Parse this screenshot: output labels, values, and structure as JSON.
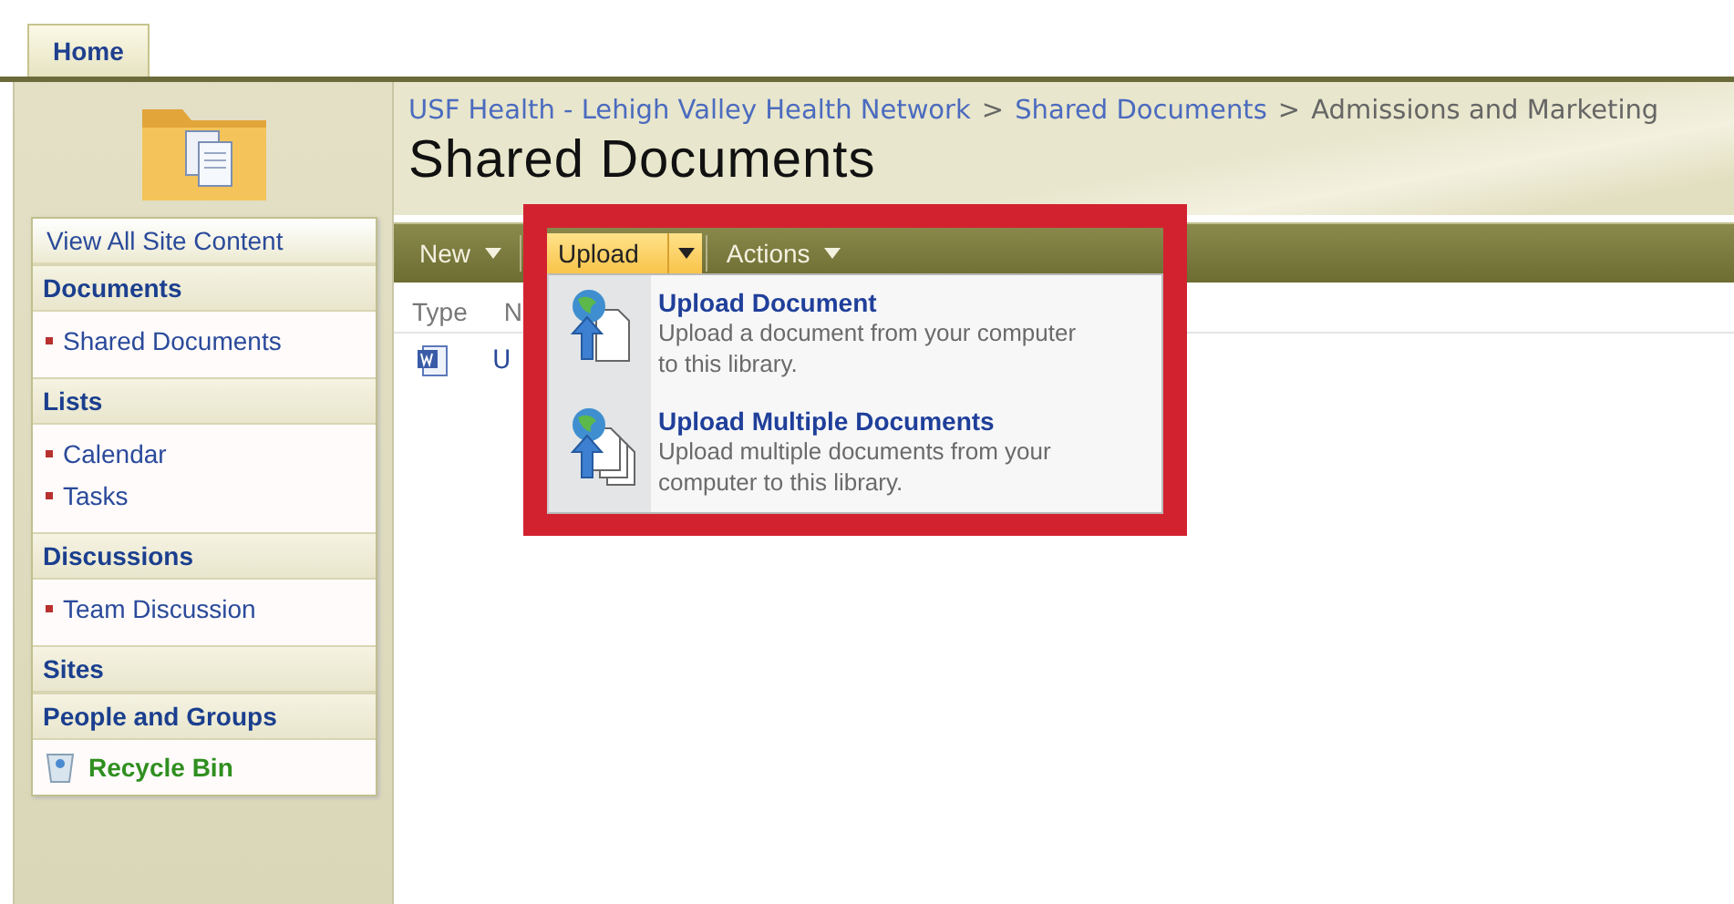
{
  "tabs": [
    {
      "label": "Home",
      "selected": true
    }
  ],
  "breadcrumb": [
    {
      "label": "USF Health - Lehigh Valley Health Network",
      "link": true
    },
    {
      "separator": ">",
      "label": "Shared Documents",
      "link": true
    },
    {
      "separator": ">",
      "label": "Admissions and Marketing",
      "link": false
    }
  ],
  "title": "Shared Documents",
  "sidebar": {
    "view_all": "View All Site Content",
    "sections": [
      {
        "heading": "Documents",
        "items": [
          "Shared Documents"
        ]
      },
      {
        "heading": "Lists",
        "items": [
          "Calendar",
          "Tasks"
        ]
      },
      {
        "heading": "Discussions",
        "items": [
          "Team Discussion"
        ]
      },
      {
        "heading": "Sites"
      },
      {
        "heading": "People and Groups"
      }
    ],
    "recycle_bin": "Recycle Bin"
  },
  "toolbar": [
    {
      "label": "New",
      "kind": "menu",
      "active": false
    },
    {
      "label": "Upload",
      "kind": "split",
      "active": true
    },
    {
      "label": "Actions",
      "kind": "menu",
      "active": false
    }
  ],
  "table": {
    "columns": [
      "Type",
      "N"
    ],
    "rows": [
      {
        "name": "U"
      }
    ]
  },
  "upload_menu": {
    "items": [
      {
        "title": "Upload Document",
        "description": "Upload a document from your computer to this library.",
        "kind": "single"
      },
      {
        "title": "Upload Multiple Documents",
        "description": "Upload multiple documents from your computer to this library.",
        "kind": "multiple"
      }
    ]
  }
}
